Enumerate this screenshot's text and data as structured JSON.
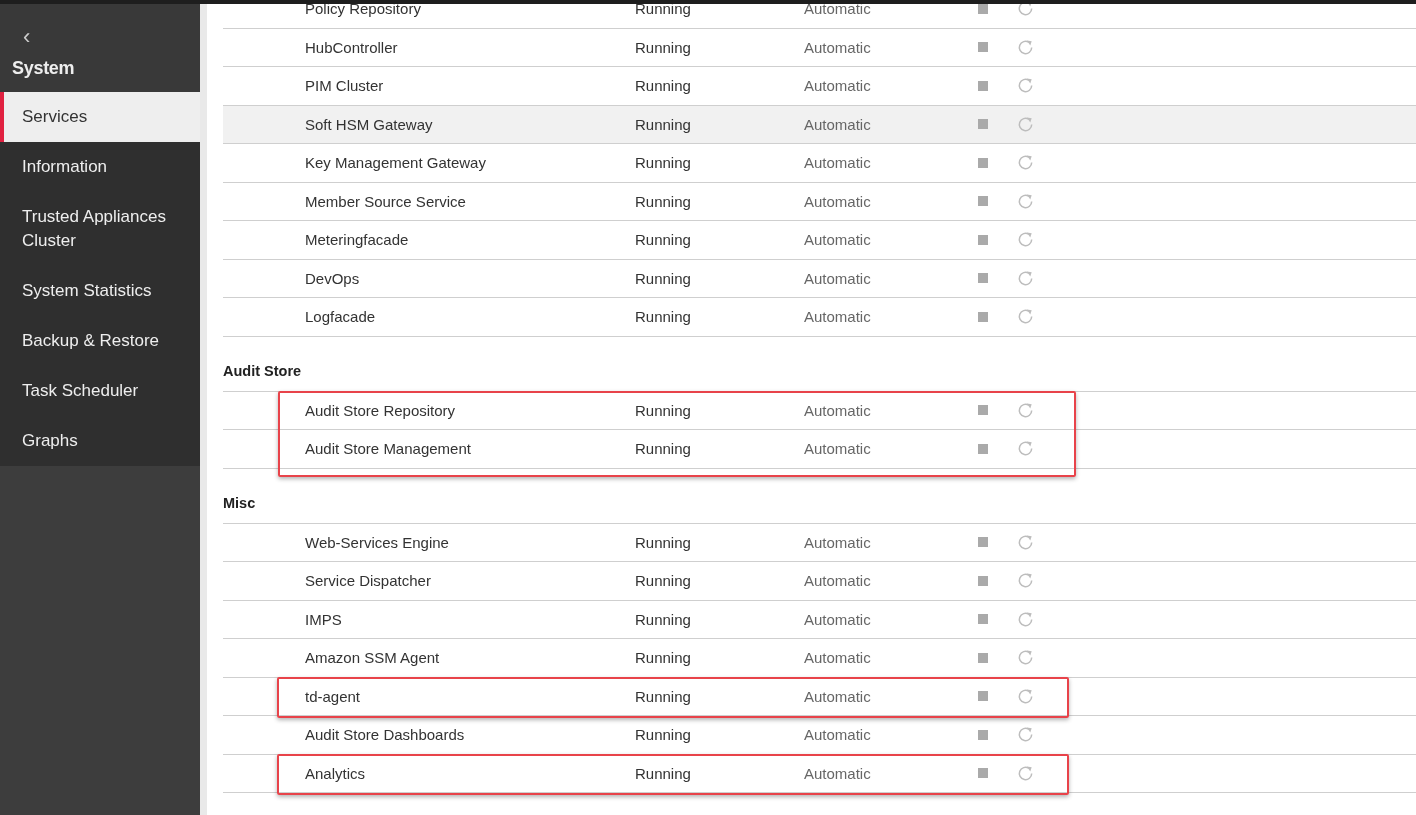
{
  "sidebar": {
    "back": "‹",
    "title": "System",
    "items": [
      {
        "label": "Services",
        "selected": true
      },
      {
        "label": "Information",
        "selected": false
      },
      {
        "label": "Trusted Appliances Cluster",
        "selected": false
      },
      {
        "label": "System Statistics",
        "selected": false
      },
      {
        "label": "Backup & Restore",
        "selected": false
      },
      {
        "label": "Task Scheduler",
        "selected": false
      },
      {
        "label": "Graphs",
        "selected": false
      }
    ]
  },
  "groups": [
    {
      "blocks": [
        {
          "outlined": false,
          "rows": [
            {
              "name": "Policy Repository",
              "status": "Running",
              "startup": "Automatic",
              "hovered": false
            },
            {
              "name": "HubController",
              "status": "Running",
              "startup": "Automatic",
              "hovered": false
            },
            {
              "name": "PIM Cluster",
              "status": "Running",
              "startup": "Automatic",
              "hovered": false
            },
            {
              "name": "Soft HSM Gateway",
              "status": "Running",
              "startup": "Automatic",
              "hovered": true
            },
            {
              "name": "Key Management Gateway",
              "status": "Running",
              "startup": "Automatic",
              "hovered": false
            },
            {
              "name": "Member Source Service",
              "status": "Running",
              "startup": "Automatic",
              "hovered": false
            },
            {
              "name": "Meteringfacade",
              "status": "Running",
              "startup": "Automatic",
              "hovered": false
            },
            {
              "name": "DevOps",
              "status": "Running",
              "startup": "Automatic",
              "hovered": false
            },
            {
              "name": "Logfacade",
              "status": "Running",
              "startup": "Automatic",
              "hovered": false
            }
          ]
        }
      ]
    },
    {
      "title": "Audit Store",
      "blocks": [
        {
          "outlined": true,
          "rows": [
            {
              "name": "Audit Store Repository",
              "status": "Running",
              "startup": "Automatic",
              "hovered": false
            },
            {
              "name": "Audit Store Management",
              "status": "Running",
              "startup": "Automatic",
              "hovered": false
            }
          ]
        }
      ]
    },
    {
      "title": "Misc",
      "blocks": [
        {
          "outlined": false,
          "rows": [
            {
              "name": "Web-Services Engine",
              "status": "Running",
              "startup": "Automatic",
              "hovered": false
            },
            {
              "name": "Service Dispatcher",
              "status": "Running",
              "startup": "Automatic",
              "hovered": false
            },
            {
              "name": "IMPS",
              "status": "Running",
              "startup": "Automatic",
              "hovered": false
            },
            {
              "name": "Amazon SSM Agent",
              "status": "Running",
              "startup": "Automatic",
              "hovered": false
            }
          ]
        },
        {
          "outlined": true,
          "rows": [
            {
              "name": "td-agent",
              "status": "Running",
              "startup": "Automatic",
              "hovered": false
            }
          ]
        },
        {
          "outlined": false,
          "rows": [
            {
              "name": "Audit Store Dashboards",
              "status": "Running",
              "startup": "Automatic",
              "hovered": false
            }
          ]
        },
        {
          "outlined": true,
          "rows": [
            {
              "name": "Analytics",
              "status": "Running",
              "startup": "Automatic",
              "hovered": false
            }
          ]
        }
      ]
    }
  ]
}
